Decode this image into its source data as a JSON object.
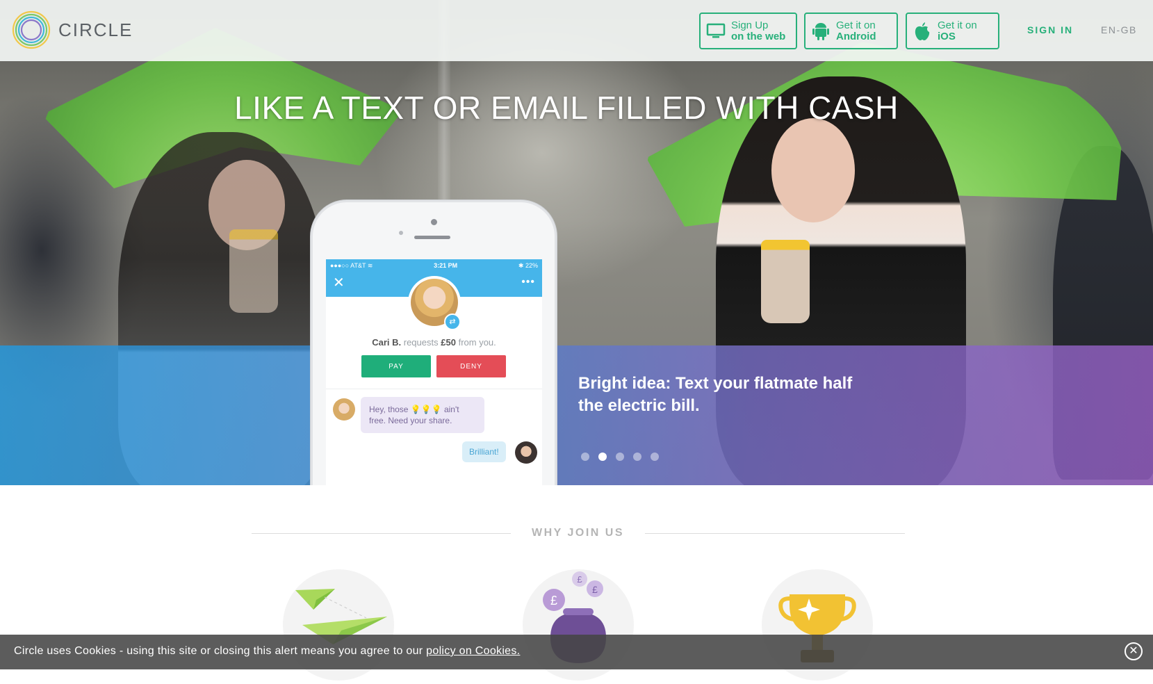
{
  "brand": {
    "name": "CIRCLE"
  },
  "header": {
    "cta_web": {
      "line1": "Sign Up",
      "line2": "on the web",
      "icon": "monitor-icon"
    },
    "cta_android": {
      "line1": "Get it on",
      "line2": "Android",
      "icon": "android-icon"
    },
    "cta_ios": {
      "line1": "Get it on",
      "line2": "iOS",
      "icon": "apple-icon"
    },
    "sign_in": "SIGN IN",
    "language": "EN-GB"
  },
  "hero": {
    "headline": "LIKE A TEXT OR EMAIL FILLED WITH CASH",
    "slide_text": "Bright idea: Text your flatmate half the electric bill.",
    "slides_count": 5,
    "active_slide": 2
  },
  "phone": {
    "status": {
      "carrier": "●●●○○ AT&T ≋",
      "time": "3:21 PM",
      "battery": "✱ 22%"
    },
    "request": {
      "name": "Cari B.",
      "verb": "requests",
      "amount": "£50",
      "suffix": "from you."
    },
    "pay_label": "PAY",
    "deny_label": "DENY",
    "messages": [
      {
        "text": "Hey, those 💡💡💡 ain't free. Need your share."
      },
      {
        "text": "Brilliant!"
      }
    ]
  },
  "why": {
    "title": "WHY JOIN US"
  },
  "cookie": {
    "text": "Circle uses Cookies - using this site or closing this alert means you agree to our",
    "link": "policy on Cookies.",
    "close": "✕"
  },
  "colors": {
    "brand_green": "#27b07a",
    "pay": "#1fae7a",
    "deny": "#e44d57",
    "app_blue": "#46b5ea"
  }
}
